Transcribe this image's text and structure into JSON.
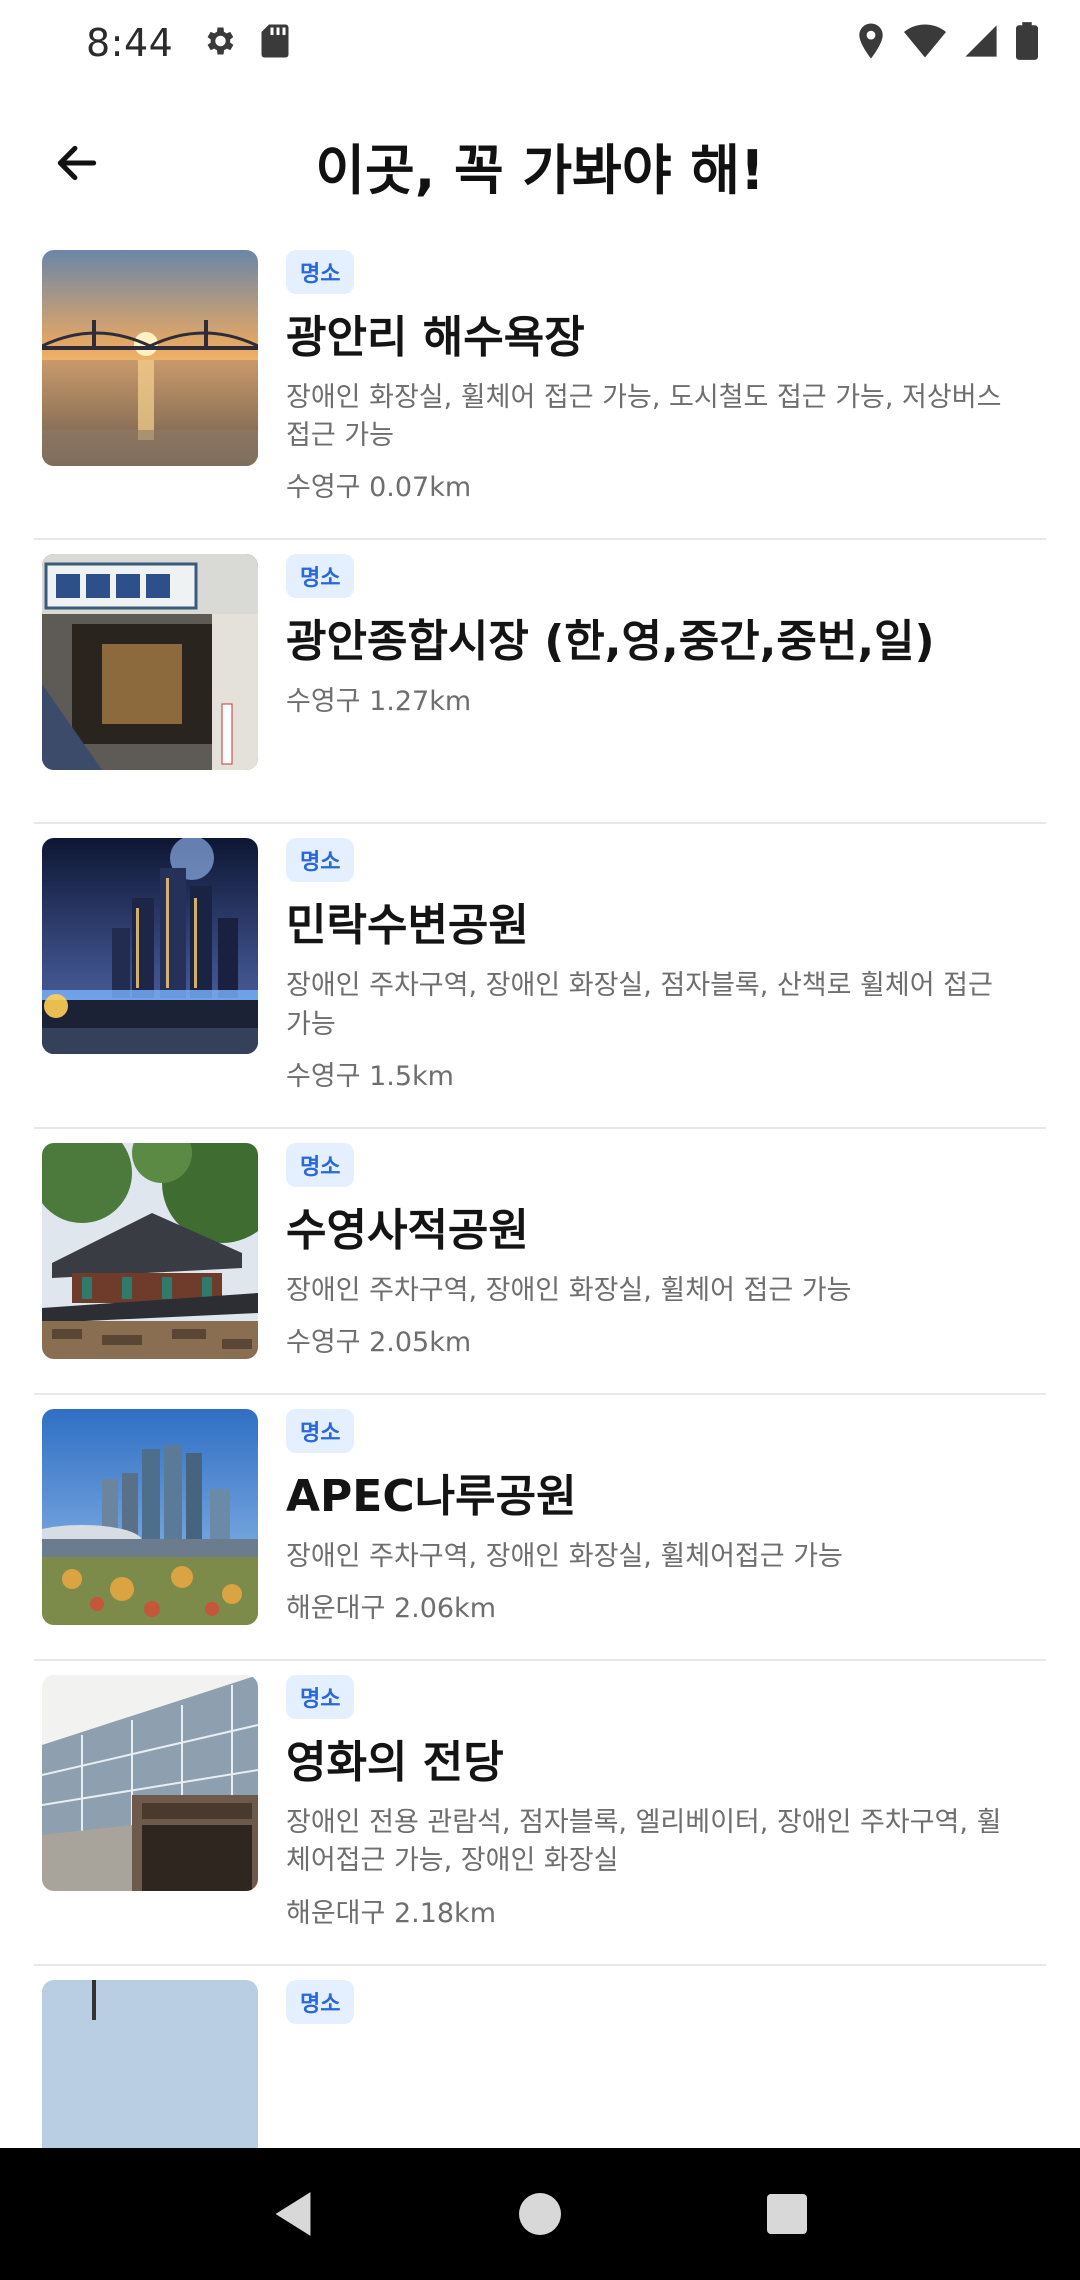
{
  "status_bar": {
    "time": "8:44",
    "icons_left": [
      "gear-icon",
      "sd-card-icon"
    ],
    "icons_right": [
      "location-icon",
      "wifi-icon",
      "signal-icon",
      "battery-icon"
    ]
  },
  "header": {
    "title": "이곳, 꼭 가봐야 해!",
    "back_icon": "arrow-left-icon"
  },
  "places": [
    {
      "badge": "명소",
      "name": "광안리 해수욕장",
      "description": "장애인 화장실, 휠체어 접근 가능, 도시철도 접근 가능, 저상버스 접근 가능",
      "distance": "수영구 0.07km"
    },
    {
      "badge": "명소",
      "name": "광안종합시장 (한,영,중간,중번,일)",
      "description": "",
      "distance": "수영구 1.27km"
    },
    {
      "badge": "명소",
      "name": "민락수변공원",
      "description": "장애인 주차구역, 장애인 화장실, 점자블록, 산책로 휠체어 접근 가능",
      "distance": "수영구 1.5km"
    },
    {
      "badge": "명소",
      "name": "수영사적공원",
      "description": "장애인 주차구역, 장애인 화장실, 휠체어 접근 가능",
      "distance": "수영구 2.05km"
    },
    {
      "badge": "명소",
      "name": "APEC나루공원",
      "description": "장애인 주차구역, 장애인 화장실, 휠체어접근 가능",
      "distance": "해운대구 2.06km"
    },
    {
      "badge": "명소",
      "name": "영화의 전당",
      "description": "장애인 전용 관람석, 점자블록, 엘리베이터, 장애인 주차구역, 휠체어접근 가능, 장애인 화장실",
      "distance": "해운대구 2.18km"
    },
    {
      "badge": "명소",
      "name": "",
      "description": "",
      "distance": ""
    }
  ],
  "nav_bar": {
    "back": "nav-back-icon",
    "home": "nav-home-icon",
    "recents": "nav-recents-icon"
  },
  "colors": {
    "badge_bg": "#e4efff",
    "badge_text": "#2868d8",
    "title_text": "#141414",
    "secondary_text": "#6e6e6e",
    "divider": "#e8e8e8"
  }
}
